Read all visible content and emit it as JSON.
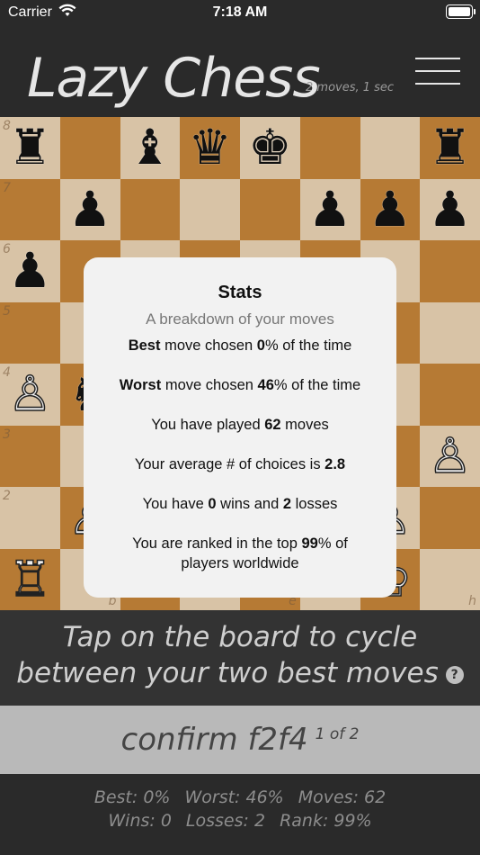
{
  "status": {
    "carrier": "Carrier",
    "time": "7:18 AM"
  },
  "header": {
    "title": "Lazy Chess",
    "meta": "2 moves, 1 sec"
  },
  "board": {
    "ranks": [
      "8",
      "7",
      "6",
      "5",
      "4",
      "3",
      "2"
    ],
    "file_h": "h",
    "file_b": "b",
    "file_e": "e",
    "colors": {
      "light": "#d8c3a6",
      "dark": "#b67a34"
    }
  },
  "stats_modal": {
    "title": "Stats",
    "subtitle": "A breakdown of your moves",
    "best": {
      "prefix": "Best",
      "text": " move chosen ",
      "value": "0",
      "suffix": "% of the time"
    },
    "worst": {
      "prefix": "Worst",
      "text": " move chosen ",
      "value": "46",
      "suffix": "% of the time"
    },
    "played": {
      "text": "You have played ",
      "value": "62",
      "suffix": " moves"
    },
    "choices": {
      "text": "Your average # of choices is ",
      "value": "2.8"
    },
    "record": {
      "text1": "You have ",
      "wins": "0",
      "text2": " wins and ",
      "losses": "2",
      "text3": " losses"
    },
    "rank": {
      "text": "You are ranked in the top ",
      "value": "99",
      "suffix": "% of",
      "line2": "players worldwide"
    }
  },
  "hint": {
    "w1": "Tap",
    "w2": " on the board to ",
    "w3": "cycle",
    "w4": "between your ",
    "w5": "two",
    "w6": " best moves",
    "help": "?"
  },
  "confirm": {
    "label": "confirm ",
    "move": "f2f4",
    "count": "1 of 2"
  },
  "footer": {
    "best": "Best: 0%",
    "worst": "Worst: 46%",
    "moves": "Moves: 62",
    "wins": "Wins: 0",
    "losses": "Losses: 2",
    "rank": "Rank: 99%"
  }
}
